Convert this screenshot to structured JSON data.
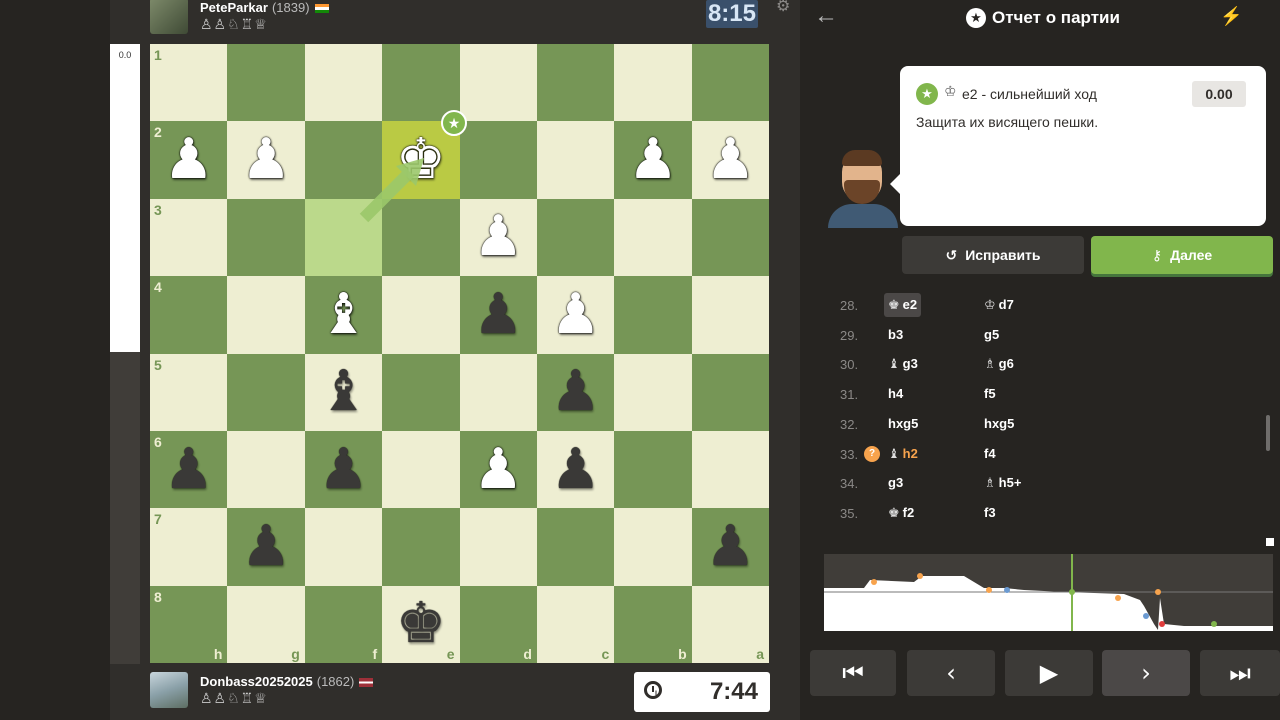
{
  "eval_bar": {
    "value": "0.0"
  },
  "top_player": {
    "name": "PeteParkar",
    "rating": "(1839)",
    "captured": "♙♙♘♖♕",
    "clock": "8:15"
  },
  "bottom_player": {
    "name": "Donbass20252025",
    "rating": "(1862)",
    "captured": "♙♙♘♖♕",
    "clock": "7:44"
  },
  "board": {
    "ranks": [
      "1",
      "2",
      "3",
      "4",
      "5",
      "6",
      "7",
      "8"
    ],
    "files": [
      "h",
      "g",
      "f",
      "e",
      "d",
      "c",
      "b",
      "a"
    ],
    "pieces": [
      {
        "sq": "r2c1",
        "glyph": "♟",
        "color": "w"
      },
      {
        "sq": "r2c2",
        "glyph": "♟",
        "color": "w"
      },
      {
        "sq": "r2c4",
        "glyph": "♚",
        "color": "w"
      },
      {
        "sq": "r2c7",
        "glyph": "♟",
        "color": "w"
      },
      {
        "sq": "r2c8",
        "glyph": "♟",
        "color": "w"
      },
      {
        "sq": "r3c5",
        "glyph": "♟",
        "color": "w"
      },
      {
        "sq": "r4c3",
        "glyph": "♝",
        "color": "w"
      },
      {
        "sq": "r4c5",
        "glyph": "♟",
        "color": "b"
      },
      {
        "sq": "r4c6",
        "glyph": "♟",
        "color": "w"
      },
      {
        "sq": "r5c3",
        "glyph": "♝",
        "color": "b"
      },
      {
        "sq": "r5c6",
        "glyph": "♟",
        "color": "b"
      },
      {
        "sq": "r6c1",
        "glyph": "♟",
        "color": "b"
      },
      {
        "sq": "r6c3",
        "glyph": "♟",
        "color": "b"
      },
      {
        "sq": "r6c5",
        "glyph": "♟",
        "color": "w"
      },
      {
        "sq": "r6c6",
        "glyph": "♟",
        "color": "b"
      },
      {
        "sq": "r7c2",
        "glyph": "♟",
        "color": "b"
      },
      {
        "sq": "r7c8",
        "glyph": "♟",
        "color": "b"
      },
      {
        "sq": "r8c4",
        "glyph": "♚",
        "color": "b"
      }
    ],
    "highlight_from": "r3c3",
    "highlight_to": "r2c4",
    "best_badge": "★"
  },
  "panel": {
    "title": "Отчет о партии",
    "coach": {
      "piece_icon": "♔",
      "move": "e2 - сильнейший ход",
      "score": "0.00",
      "description": "Защита их висящего пешки."
    },
    "retry_label": "Исправить",
    "next_label": "Далее",
    "moves": [
      {
        "n": "28.",
        "w": "e2",
        "wi": "♚",
        "b": "d7",
        "bi": "♔",
        "sel": true
      },
      {
        "n": "29.",
        "w": "b3",
        "wi": "",
        "b": "g5",
        "bi": ""
      },
      {
        "n": "30.",
        "w": "g3",
        "wi": "♝",
        "b": "g6",
        "bi": "♗"
      },
      {
        "n": "31.",
        "w": "h4",
        "wi": "",
        "b": "f5",
        "bi": ""
      },
      {
        "n": "32.",
        "w": "hxg5",
        "wi": "",
        "b": "hxg5",
        "bi": ""
      },
      {
        "n": "33.",
        "w": "h2",
        "wi": "♝",
        "b": "f4",
        "bi": "",
        "miss": true
      },
      {
        "n": "34.",
        "w": "g3",
        "wi": "",
        "b": "h5+",
        "bi": "♗"
      },
      {
        "n": "35.",
        "w": "f2",
        "wi": "♚",
        "b": "f3",
        "bi": ""
      }
    ],
    "controls": [
      "first",
      "prev",
      "play",
      "next",
      "last"
    ]
  },
  "colors": {
    "accent": "#81b64c",
    "board_light": "#eeeed2",
    "board_dark": "#769656",
    "miss": "#f7a34d"
  }
}
